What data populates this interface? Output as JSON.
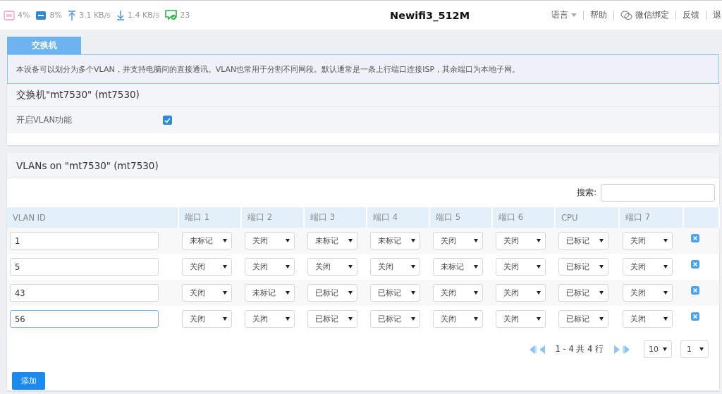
{
  "status": [
    {
      "kind": "cpu",
      "value": "4%"
    },
    {
      "kind": "ram",
      "value": "8%"
    },
    {
      "kind": "upload",
      "value": "3.1 KB/s"
    },
    {
      "kind": "download",
      "value": "1.4 KB/s"
    },
    {
      "kind": "clients",
      "value": "23"
    }
  ],
  "title": "Newifi3_512M",
  "nav": [
    {
      "label": "语言",
      "kind": "dropdown"
    },
    {
      "label": "帮助",
      "kind": "link"
    },
    {
      "label": "微信绑定",
      "kind": "wechat"
    },
    {
      "label": "反馈",
      "kind": "link"
    },
    {
      "label": "退",
      "kind": "link"
    }
  ],
  "tabs": [
    {
      "label": "交换机",
      "selected": true
    }
  ],
  "description": "本设备可以划分为多个VLAN，并支持电脑间的直接通讯。VLAN也常用于分割不同网段。默认通常是一条上行端口连接ISP，其余端口为本地子网。",
  "switch_section": {
    "title": "交换机\"mt7530\" (mt7530)",
    "option": {
      "label": "开启VLAN功能",
      "checked": true
    }
  },
  "vlan_table": {
    "title": "VLANs on \"mt7530\" (mt7530)",
    "search_label": "搜索:",
    "columns": [
      "VLAN ID",
      "端口 1",
      "端口 2",
      "端口 3",
      "端口 4",
      "端口 5",
      "端口 6",
      "CPU",
      "端口 7"
    ],
    "rows": [
      {
        "vlan_id": "1",
        "focused": false,
        "ports": [
          "未标记",
          "关闭",
          "未标记",
          "未标记",
          "关闭",
          "关闭",
          "已标记",
          "关闭"
        ]
      },
      {
        "vlan_id": "5",
        "focused": false,
        "ports": [
          "关闭",
          "关闭",
          "关闭",
          "关闭",
          "未标记",
          "关闭",
          "已标记",
          "关闭"
        ]
      },
      {
        "vlan_id": "43",
        "focused": false,
        "ports": [
          "关闭",
          "未标记",
          "已标记",
          "已标记",
          "关闭",
          "关闭",
          "已标记",
          "关闭"
        ]
      },
      {
        "vlan_id": "56",
        "focused": true,
        "ports": [
          "关闭",
          "关闭",
          "已标记",
          "已标记",
          "关闭",
          "关闭",
          "已标记",
          "关闭"
        ]
      }
    ],
    "pagination": {
      "range": "1 - 4 共 4 行",
      "page_size": "10",
      "page": "1"
    },
    "add_button": "添加"
  }
}
